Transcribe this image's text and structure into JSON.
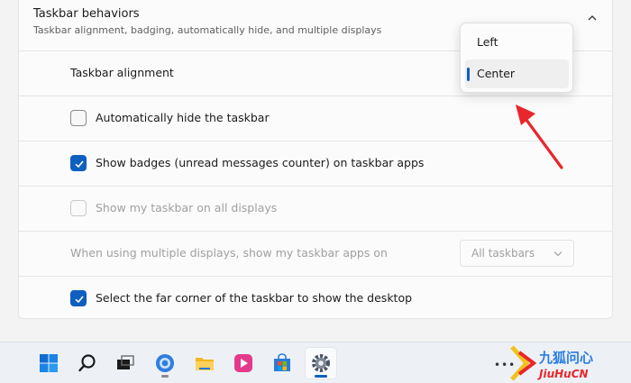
{
  "section": {
    "title": "Taskbar behaviors",
    "subtitle": "Taskbar alignment, badging, automatically hide, and multiple displays"
  },
  "alignment": {
    "label": "Taskbar alignment",
    "options": [
      "Left",
      "Center"
    ],
    "selected": "Center"
  },
  "settings": [
    {
      "label": "Automatically hide the taskbar",
      "checked": false,
      "disabled": false
    },
    {
      "label": "Show badges (unread messages counter) on taskbar apps",
      "checked": true,
      "disabled": false
    },
    {
      "label": "Show my taskbar on all displays",
      "checked": false,
      "disabled": true
    }
  ],
  "multi_display": {
    "label": "When using multiple displays, show my taskbar apps on",
    "value": "All taskbars"
  },
  "desktop_corner": {
    "label": "Select the far corner of the taskbar to show the desktop",
    "checked": true
  },
  "taskbar": {
    "icons": [
      "windows-start-icon",
      "search-icon",
      "task-view-icon",
      "browser-icon",
      "file-explorer-icon",
      "media-player-icon",
      "store-icon",
      "settings-gear-icon"
    ],
    "active": "settings-gear-icon",
    "tray_overflow": "•••"
  },
  "watermark": {
    "text_cn": "九狐问心",
    "text_en": "JiuHuCN"
  },
  "colors": {
    "accent": "#0f5fc0",
    "arrow": "#e8262b"
  }
}
